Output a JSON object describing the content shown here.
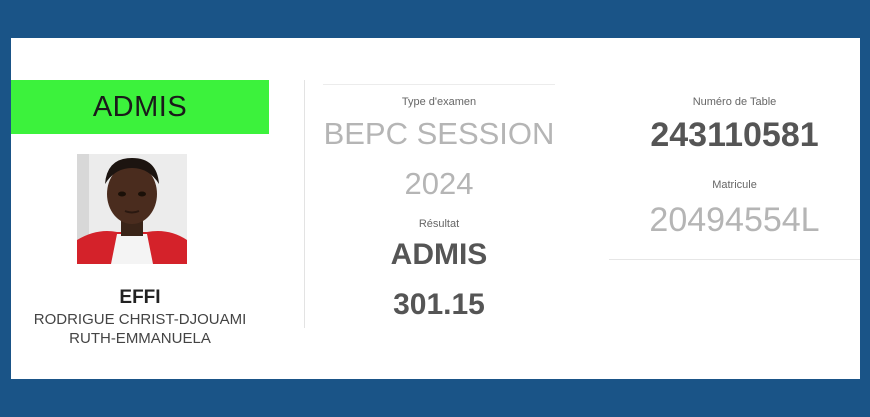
{
  "candidate": {
    "status": "ADMIS",
    "last_name": "EFFI",
    "first_names_line1": "RODRIGUE CHRIST-DJOUAMI",
    "first_names_line2": "RUTH-EMMANUELA"
  },
  "exam": {
    "type_label": "Type d'examen",
    "type_value_line1": "BEPC SESSION",
    "type_value_line2": "2024",
    "result_label": "Résultat",
    "result_value": "ADMIS",
    "score": "301.15"
  },
  "identity": {
    "table_label": "Numéro de Table",
    "table_number": "243110581",
    "matricule_label": "Matricule",
    "matricule_value": "20494554L"
  },
  "colors": {
    "frame": "#1a5487",
    "status_banner": "#3cf23c",
    "strong_text": "#555555",
    "muted_text": "#b5b5b5"
  }
}
